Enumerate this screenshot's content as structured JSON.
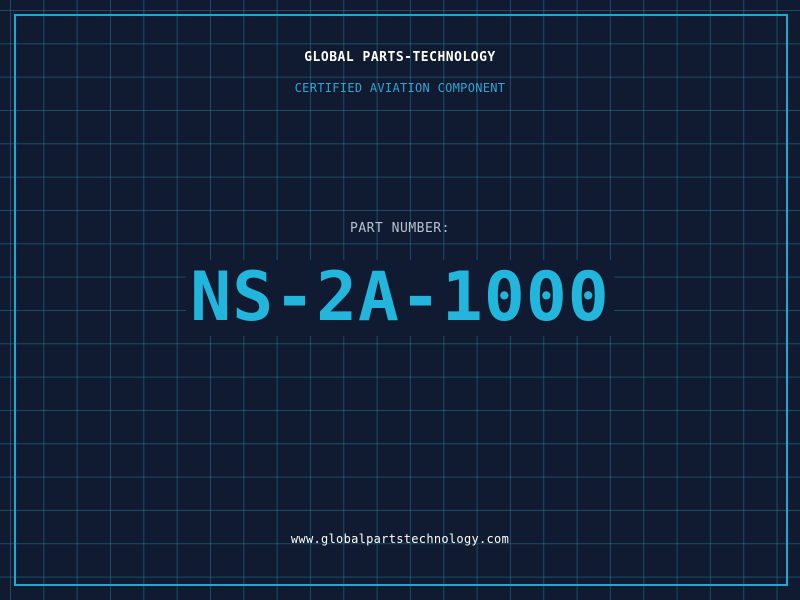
{
  "label": {
    "company": "GLOBAL PARTS-TECHNOLOGY",
    "subtitle": "CERTIFIED AVIATION COMPONENT",
    "part_number_label": "PART NUMBER:",
    "part_number": "NS-2A-1000",
    "website": "www.globalpartstechnology.com"
  },
  "colors": {
    "background": "#101a30",
    "grid": "#288ca5",
    "frame": "#1fa8d0",
    "part_number": "#22b6dc",
    "subtitle": "#2fa6d6"
  }
}
